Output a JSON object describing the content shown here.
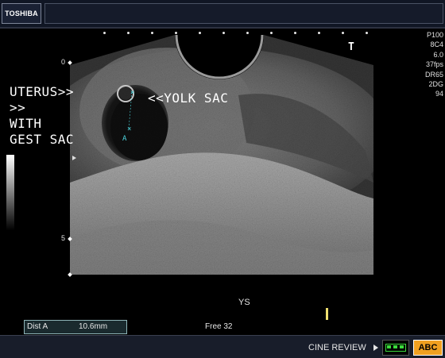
{
  "header": {
    "brand": "TOSHIBA"
  },
  "params": [
    "P100",
    "8C4",
    "6.0",
    "37fps",
    "DR65",
    "2DG",
    "94"
  ],
  "depth_scale": {
    "top_label": "0",
    "mid_label": "5"
  },
  "probe_marker": "T",
  "annotations": {
    "uterus_line1": "UTERUS>>",
    "uterus_line2": ">>",
    "uterus_line3": "WITH",
    "uterus_line4": "GEST SAC",
    "yolk_sac": "<<YOLK SAC",
    "caliper_label": "A"
  },
  "image_label": "YS",
  "measurement": {
    "name": "Dist A",
    "value": "10.6mm"
  },
  "memory": "Free 32",
  "footer": {
    "cine_review": "CINE REVIEW",
    "abc_label": "ABC"
  },
  "colors": {
    "caliper": "#4fd6e0",
    "abc_button": "#f0a020",
    "cine_icon": "#3cdc3c",
    "marker": "#f0e070"
  }
}
